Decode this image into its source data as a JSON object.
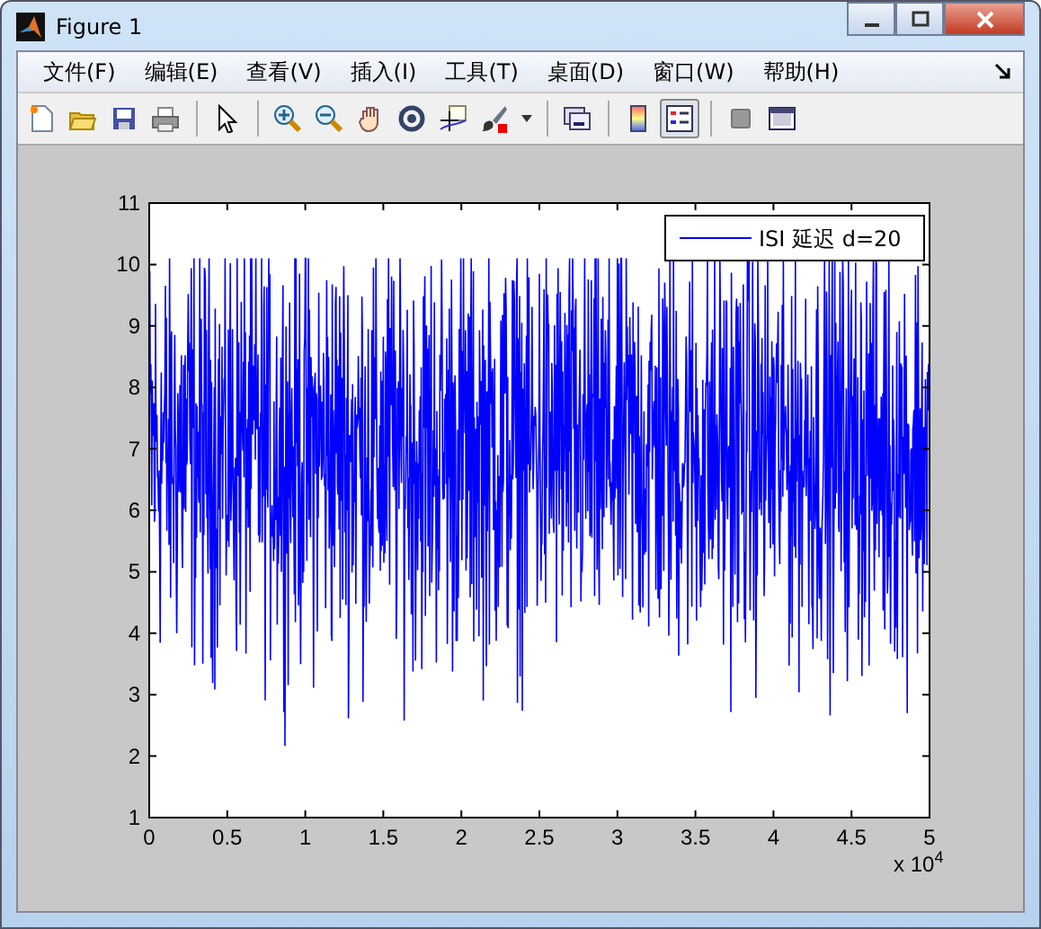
{
  "window": {
    "title": "Figure 1"
  },
  "menu": [
    {
      "label": "文件(F)"
    },
    {
      "label": "编辑(E)"
    },
    {
      "label": "查看(V)"
    },
    {
      "label": "插入(I)"
    },
    {
      "label": "工具(T)"
    },
    {
      "label": "桌面(D)"
    },
    {
      "label": "窗口(W)"
    },
    {
      "label": "帮助(H)"
    }
  ],
  "toolbar": [
    [
      {
        "pressed": false
      },
      {
        "pressed": false
      },
      {
        "pressed": false
      },
      {
        "pressed": false
      }
    ],
    [
      {
        "pressed": false
      }
    ],
    [
      {
        "pressed": false
      },
      {
        "pressed": false
      },
      {
        "pressed": false
      },
      {
        "pressed": false
      },
      {
        "pressed": false
      },
      {
        "pressed": false
      }
    ],
    [
      {
        "pressed": false
      }
    ],
    [
      {
        "pressed": false
      },
      {
        "pressed": true
      }
    ],
    [
      {
        "pressed": false
      },
      {
        "pressed": false
      }
    ]
  ],
  "axes": {
    "yticks": [
      "11",
      "10",
      "9",
      "8",
      "7",
      "6",
      "5",
      "4",
      "3",
      "2",
      "1"
    ],
    "xticks": [
      "0",
      "0.5",
      "1",
      "1.5",
      "2",
      "2.5",
      "3",
      "3.5",
      "4",
      "4.5",
      "5"
    ],
    "x_exponent": {
      "base": "x 10",
      "power": "4"
    },
    "legend": {
      "label": "ISI 延迟 d=20",
      "color": "#0000ff"
    }
  }
}
